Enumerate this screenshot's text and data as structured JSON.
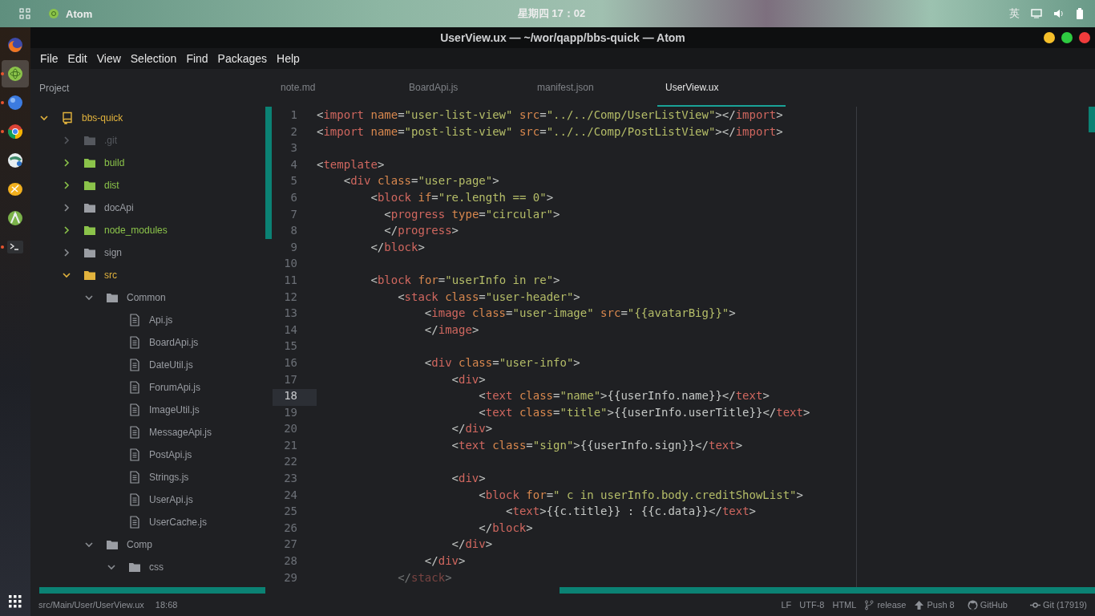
{
  "top_bar": {
    "app": "Atom",
    "clock": "星期四 17：02",
    "input_method": "英"
  },
  "dock": [
    {
      "kind": "fox",
      "running": false,
      "selected": false
    },
    {
      "kind": "atom",
      "running": true,
      "selected": true
    },
    {
      "kind": "ball",
      "running": true,
      "selected": false
    },
    {
      "kind": "wheel",
      "running": true,
      "selected": false
    },
    {
      "kind": "globe",
      "running": false,
      "selected": false
    },
    {
      "kind": "lemon",
      "running": false,
      "selected": false
    },
    {
      "kind": "robot",
      "running": false,
      "selected": false
    },
    {
      "kind": "terminal",
      "running": true,
      "selected": false
    }
  ],
  "window": {
    "title": "UserView.ux — ~/wor/qapp/bbs-quick — Atom"
  },
  "menu": [
    "File",
    "Edit",
    "View",
    "Selection",
    "Find",
    "Packages",
    "Help"
  ],
  "tree_panel": {
    "title": "Project"
  },
  "tabs": [
    {
      "label": "note.md",
      "selected": false
    },
    {
      "label": "BoardApi.js",
      "selected": false
    },
    {
      "label": "manifest.json",
      "selected": false
    },
    {
      "label": "UserView.ux",
      "selected": true
    }
  ],
  "tree": {
    "label": "bbs-quick",
    "kind": "repo",
    "color": "#e2b33d",
    "expanded": true,
    "children": [
      {
        "label": ".git",
        "kind": "folder",
        "color": "#55585e",
        "expanded": false
      },
      {
        "label": "build",
        "kind": "folder",
        "color": "#8bc34a",
        "expanded": false
      },
      {
        "label": "dist",
        "kind": "folder",
        "color": "#8bc34a",
        "expanded": false
      },
      {
        "label": "docApi",
        "kind": "folder",
        "color": "#9a9da3",
        "expanded": false
      },
      {
        "label": "node_modules",
        "kind": "folder",
        "color": "#8bc34a",
        "expanded": false
      },
      {
        "label": "sign",
        "kind": "folder",
        "color": "#9a9da3",
        "expanded": false
      },
      {
        "label": "src",
        "kind": "folder",
        "color": "#e2b33d",
        "expanded": true,
        "children": [
          {
            "label": "Common",
            "kind": "folder",
            "color": "#9a9da3",
            "expanded": true,
            "children": [
              {
                "label": "Api.js",
                "kind": "file",
                "color": "#9a9da3"
              },
              {
                "label": "BoardApi.js",
                "kind": "file",
                "color": "#9a9da3"
              },
              {
                "label": "DateUtil.js",
                "kind": "file",
                "color": "#9a9da3"
              },
              {
                "label": "ForumApi.js",
                "kind": "file",
                "color": "#9a9da3"
              },
              {
                "label": "ImageUtil.js",
                "kind": "file",
                "color": "#9a9da3"
              },
              {
                "label": "MessageApi.js",
                "kind": "file",
                "color": "#9a9da3"
              },
              {
                "label": "PostApi.js",
                "kind": "file",
                "color": "#9a9da3"
              },
              {
                "label": "Strings.js",
                "kind": "file",
                "color": "#9a9da3"
              },
              {
                "label": "UserApi.js",
                "kind": "file",
                "color": "#9a9da3"
              },
              {
                "label": "UserCache.js",
                "kind": "file",
                "color": "#9a9da3"
              }
            ]
          },
          {
            "label": "Comp",
            "kind": "folder",
            "color": "#9a9da3",
            "expanded": true,
            "children": [
              {
                "label": "css",
                "kind": "folder",
                "color": "#9a9da3",
                "expanded": true
              }
            ]
          }
        ]
      }
    ]
  },
  "editor": {
    "lines": [
      {
        "number": "1",
        "current": false,
        "text": "<import name=\"user-list-view\" src=\"../../Comp/UserListView\"></import>"
      },
      {
        "number": "2",
        "current": false,
        "text": "<import name=\"post-list-view\" src=\"../../Comp/PostListView\"></import>"
      },
      {
        "number": "3",
        "current": false
      },
      {
        "number": "4",
        "current": false,
        "text": "<template>"
      },
      {
        "number": "5",
        "current": false,
        "text": "    <div class=\"user-page\">"
      },
      {
        "number": "6",
        "current": false,
        "text": "        <block if=\"re.length == 0\">"
      },
      {
        "number": "7",
        "current": false,
        "text": "          <progress type=\"circular\">"
      },
      {
        "number": "8",
        "current": false,
        "text": "          </progress>"
      },
      {
        "number": "9",
        "current": false,
        "text": "        </block>"
      },
      {
        "number": "10",
        "current": false
      },
      {
        "number": "11",
        "current": false,
        "text": "        <block for=\"userInfo in re\">"
      },
      {
        "number": "12",
        "current": false,
        "text": "            <stack class=\"user-header\">"
      },
      {
        "number": "13",
        "current": false,
        "text": "                <image class=\"user-image\" src=\"{{avatarBig}}\">"
      },
      {
        "number": "14",
        "current": false,
        "text": "                </image>"
      },
      {
        "number": "15",
        "current": false
      },
      {
        "number": "16",
        "current": false,
        "text": "                <div class=\"user-info\">"
      },
      {
        "number": "17",
        "current": false,
        "text": "                    <div>"
      },
      {
        "number": "18",
        "current": true,
        "text": "                        <text class=\"name\">{{userInfo.name}}</text>"
      },
      {
        "number": "19",
        "current": false,
        "text": "                        <text class=\"title\">{{userInfo.userTitle}}</text>"
      },
      {
        "number": "20",
        "current": false,
        "text": "                    </div>"
      },
      {
        "number": "21",
        "current": false,
        "text": "                    <text class=\"sign\">{{userInfo.sign}}</text>"
      },
      {
        "number": "22",
        "current": false
      },
      {
        "number": "23",
        "current": false,
        "text": "                    <div>"
      },
      {
        "number": "24",
        "current": false,
        "text": "                        <block for=\" c in userInfo.body.creditShowList\">"
      },
      {
        "number": "25",
        "current": false,
        "text": "                            <text>{{c.title}} : {{c.data}}</text>"
      },
      {
        "number": "26",
        "current": false,
        "text": "                        </block>"
      },
      {
        "number": "27",
        "current": false,
        "text": "                    </div>"
      },
      {
        "number": "28",
        "current": false,
        "text": "                </div>"
      },
      {
        "number": "29",
        "current": false,
        "text": "            </stack>"
      }
    ]
  },
  "status_bar": {
    "left": [
      "src/Main/User/UserView.ux",
      "18:68"
    ],
    "right": [
      {
        "kind": "plain",
        "text": "LF"
      },
      {
        "kind": "plain",
        "text": "UTF-8"
      },
      {
        "kind": "plain",
        "text": "HTML"
      },
      {
        "kind": "branch",
        "text": "release"
      },
      {
        "kind": "push",
        "text": "Push 8"
      },
      {
        "kind": "github",
        "text": "GitHub"
      },
      {
        "kind": "commit",
        "text": "Git (17919)"
      }
    ]
  }
}
